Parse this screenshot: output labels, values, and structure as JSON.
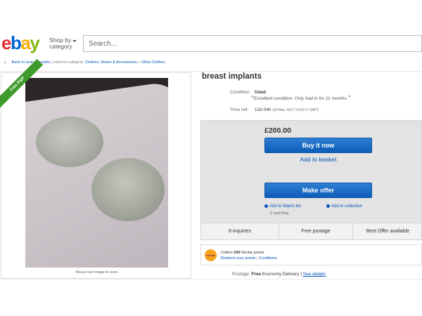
{
  "header": {
    "logo": {
      "e": "e",
      "b": "b",
      "a": "a",
      "y": "y"
    },
    "shop_by_line1": "Shop by",
    "shop_by_line2": "category",
    "search_placeholder": "Search..."
  },
  "breadcrumb": {
    "back": "Back to search results",
    "listed_in": "Listed in category:",
    "path": [
      "Clothes, Shoes & Accessories",
      "Other Clothes"
    ],
    "separator": ">",
    "pipe": "|"
  },
  "image_panel": {
    "ribbon": "Free P&P",
    "caption": "Mouse over image to zoom"
  },
  "listing": {
    "title": "breast implants",
    "condition_label": "Condition:",
    "condition_value": "Used",
    "condition_note": "Excellent condition. Only had in for 11 months.",
    "time_left_label": "Time left:",
    "time_left_value": "12d 04h",
    "time_left_date": "(15 Mar, 2017 14:20:17 GMT)"
  },
  "buybox": {
    "price": "£200.00",
    "buy_now": "Buy it now",
    "add_to_basket": "Add to basket",
    "make_offer": "Make offer",
    "watch_list": "Add to Watch list",
    "watching": "2 watching",
    "collection": "Add to collection"
  },
  "stats": {
    "inquiries": "8 inquiries",
    "postage": "Free postage",
    "offer": "Best Offer available"
  },
  "nectar": {
    "logo": "nectar",
    "collect_prefix": "Collect",
    "points": "200",
    "collect_suffix": "Nectar points",
    "redeem": "Redeem your points",
    "conditions": "Conditions",
    "pipe": "|"
  },
  "postage": {
    "label": "Postage:",
    "free": "Free",
    "method": "Economy Delivery",
    "pipe": "|",
    "see_details": "See details"
  },
  "colors": {
    "logo_e": "#e53238",
    "logo_b": "#0064d2",
    "logo_a": "#f5af02",
    "logo_y": "#86b817",
    "button_blue": "#1c6bc7",
    "link_blue": "#0654ba",
    "ribbon_green": "#3f9a2c"
  }
}
